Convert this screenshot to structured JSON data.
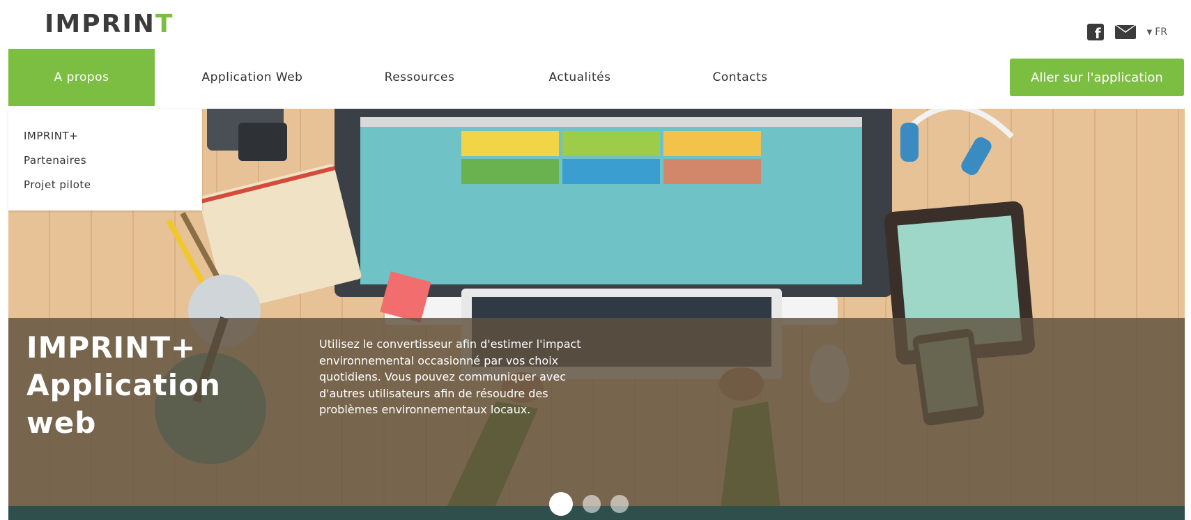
{
  "brand": {
    "logo_text": "IMPRIN",
    "logo_plus": "T"
  },
  "top_icons": {
    "facebook": "f",
    "lang_caret": "▼",
    "lang": "FR"
  },
  "nav": {
    "items": [
      {
        "label": "A propos"
      },
      {
        "label": "Application Web"
      },
      {
        "label": "Ressources"
      },
      {
        "label": "Actualités"
      },
      {
        "label": "Contacts"
      }
    ],
    "cta": "Aller sur l'application"
  },
  "dropdown": {
    "items": [
      {
        "label": "IMPRINT+"
      },
      {
        "label": "Partenaires"
      },
      {
        "label": "Projet pilote"
      }
    ]
  },
  "hero": {
    "title": "IMPRINT+\nApplication\nweb",
    "text": "Utilisez le convertisseur afin d'estimer l'impact environnemental occasionné par vos choix quotidiens. Vous pouvez communiquer avec d'autres utilisateurs afin de résoudre des problèmes environnementaux locaux."
  },
  "carousel": {
    "active_index": 0,
    "count": 3
  },
  "colors": {
    "accent": "#7cbe42",
    "text_dark": "#333333",
    "overlay": "#5f503e"
  }
}
